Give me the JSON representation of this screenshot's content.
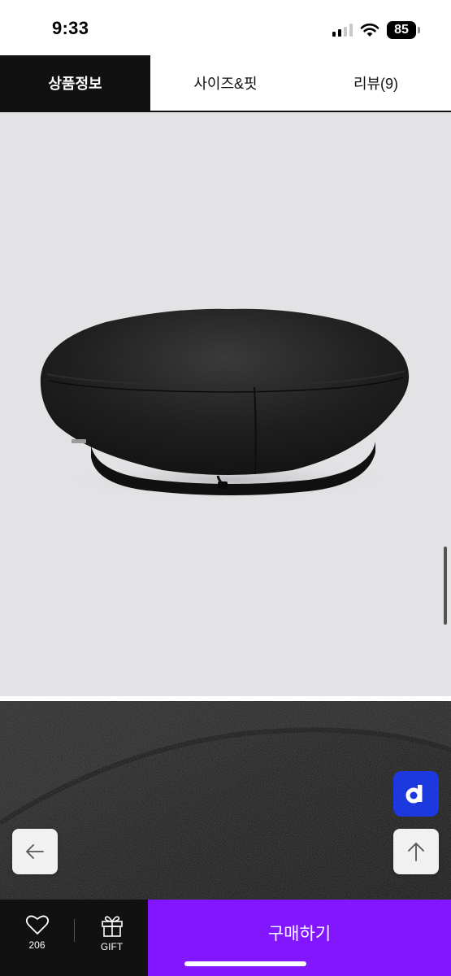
{
  "status_bar": {
    "time": "9:33",
    "battery": "85",
    "icons": [
      "signal-icon",
      "wifi-icon",
      "battery-icon"
    ]
  },
  "tabs": [
    {
      "label": "상품정보",
      "active": true
    },
    {
      "label": "사이즈&핏",
      "active": false
    },
    {
      "label": "리뷰(9)",
      "active": false
    }
  ],
  "product_image": {
    "subject": "black wool beret on light grey background",
    "background": "#e3e3e5"
  },
  "detail_image": {
    "subject": "close-up of black wool fabric texture"
  },
  "floating": {
    "app_badge_letter": "d",
    "app_badge_color": "#1c39e0",
    "back_icon": "arrow-left-icon",
    "top_icon": "arrow-up-icon"
  },
  "bottom_bar": {
    "like_count": "206",
    "gift_label": "GIFT",
    "buy_label": "구매하기",
    "buy_color": "#8216ff"
  }
}
